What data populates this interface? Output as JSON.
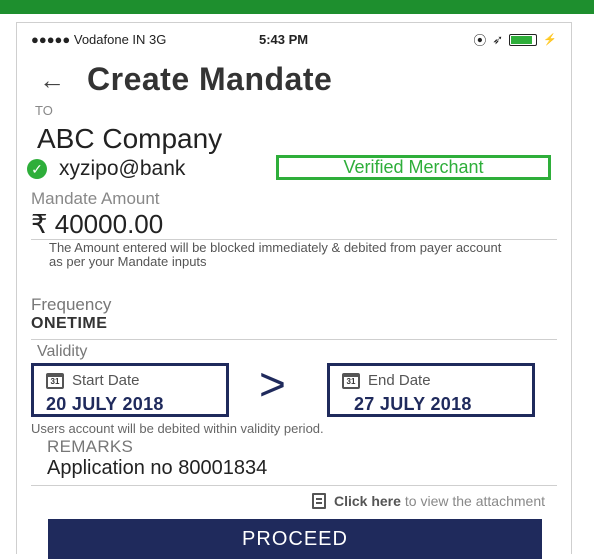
{
  "status_bar": {
    "carrier": "●●●●● Vodafone IN  3G",
    "time": "5:43 PM",
    "icons": [
      "location-icon",
      "arrow-icon",
      "battery-icon"
    ]
  },
  "header": {
    "back_icon": "back-arrow-icon",
    "title": "Create Mandate"
  },
  "payee": {
    "to_label": "TO",
    "name": "ABC Company",
    "vpa": "xyzipo@bank",
    "verified_badge": "Verified Merchant"
  },
  "amount": {
    "label": "Mandate Amount",
    "value": "₹ 40000.00",
    "note": "The Amount entered will be blocked immediately & debited from payer account as per your Mandate inputs"
  },
  "frequency": {
    "label": "Frequency",
    "value": "ONETIME"
  },
  "validity": {
    "label": "Validity",
    "start_label": "Start Date",
    "start_date": "20 JULY 2018",
    "end_label": "End Date",
    "end_date": "27 JULY 2018",
    "calendar_text": "31",
    "separator": ">",
    "note": "Users account will be debited within validity period."
  },
  "remarks": {
    "label": "REMARKS",
    "value": "Application no 80001834"
  },
  "attachment": {
    "click_label": "Click here",
    "rest": "to view the attachment"
  },
  "proceed_label": "PROCEED",
  "colors": {
    "accent_green": "#2eae3a",
    "navy": "#1f2a5c",
    "top_band": "#1e8f2e"
  }
}
